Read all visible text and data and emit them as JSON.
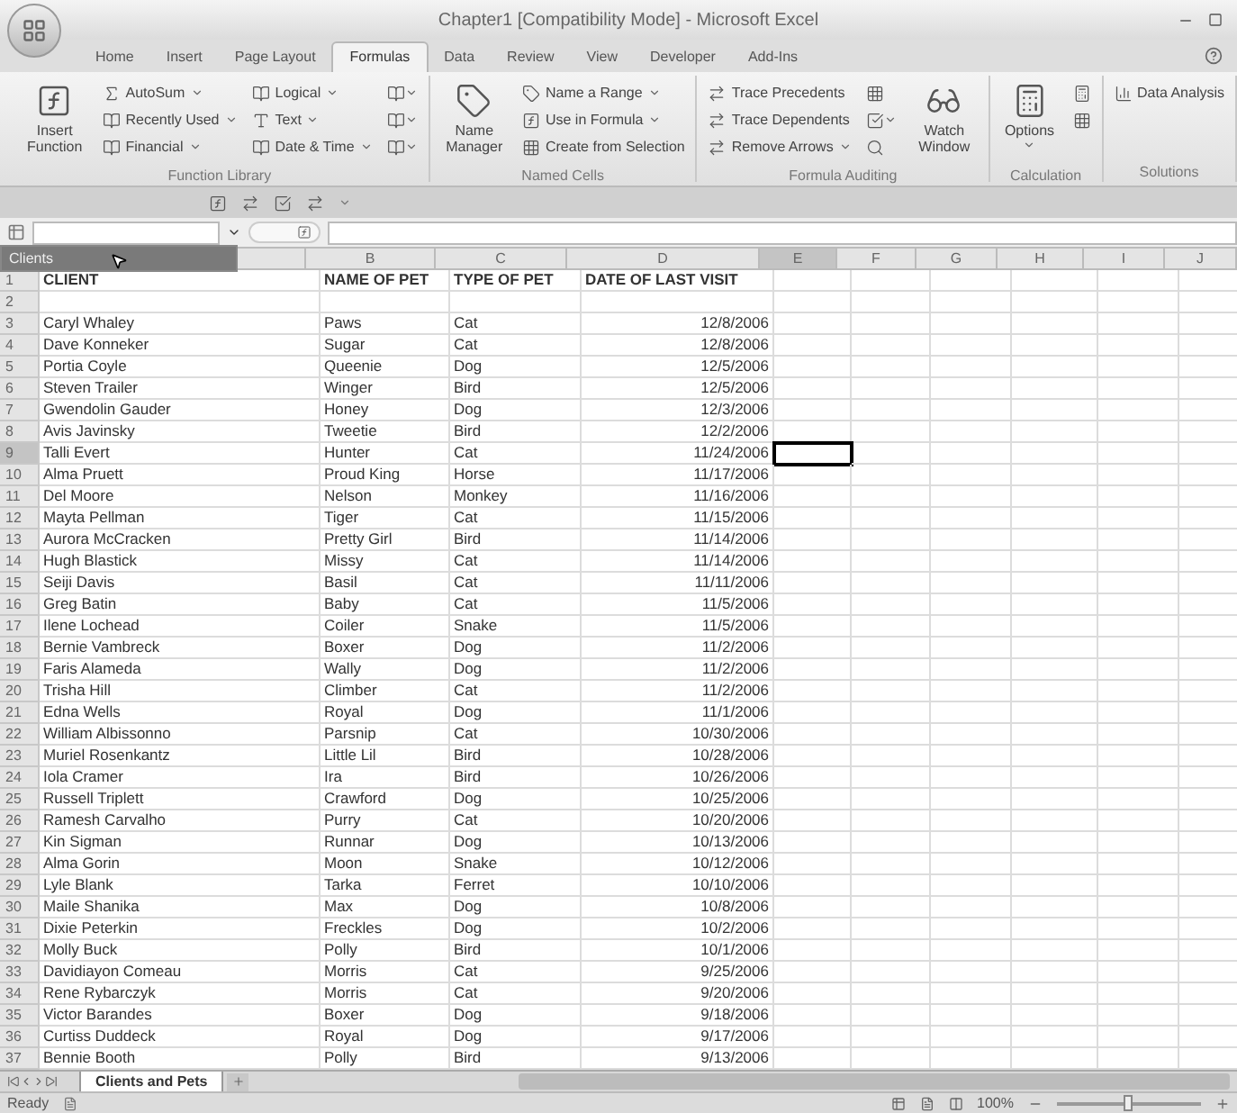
{
  "window": {
    "title": "Chapter1  [Compatibility Mode] - Microsoft Excel"
  },
  "tabs": [
    {
      "label": "Home",
      "selected": false
    },
    {
      "label": "Insert",
      "selected": false
    },
    {
      "label": "Page Layout",
      "selected": false
    },
    {
      "label": "Formulas",
      "selected": true
    },
    {
      "label": "Data",
      "selected": false
    },
    {
      "label": "Review",
      "selected": false
    },
    {
      "label": "View",
      "selected": false
    },
    {
      "label": "Developer",
      "selected": false
    },
    {
      "label": "Add-Ins",
      "selected": false
    }
  ],
  "ribbon_groups": [
    {
      "label": "Function Library",
      "items": [
        {
          "kind": "large",
          "label": "Insert Function",
          "menu": false
        },
        {
          "kind": "small",
          "label": "AutoSum",
          "menu": true
        },
        {
          "kind": "small",
          "label": "Recently Used",
          "menu": true
        },
        {
          "kind": "small",
          "label": "Financial",
          "menu": true
        },
        {
          "kind": "small",
          "label": "Logical",
          "menu": true
        },
        {
          "kind": "small",
          "label": "Text",
          "menu": true
        },
        {
          "kind": "small",
          "label": "Date & Time",
          "menu": true
        },
        {
          "kind": "icon",
          "menu": true
        },
        {
          "kind": "icon",
          "menu": true
        },
        {
          "kind": "icon",
          "menu": true
        }
      ]
    },
    {
      "label": "Named Cells",
      "items": [
        {
          "kind": "large",
          "label": "Name Manager",
          "menu": false
        },
        {
          "kind": "small",
          "label": "Name a Range",
          "menu": true
        },
        {
          "kind": "small",
          "label": "Use in Formula",
          "menu": true
        },
        {
          "kind": "small",
          "label": "Create from Selection",
          "menu": false
        }
      ]
    },
    {
      "label": "Formula Auditing",
      "items": [
        {
          "kind": "small",
          "label": "Trace Precedents",
          "menu": false
        },
        {
          "kind": "small",
          "label": "Trace Dependents",
          "menu": false
        },
        {
          "kind": "small",
          "label": "Remove Arrows",
          "menu": true
        },
        {
          "kind": "icon",
          "menu": false
        },
        {
          "kind": "icon",
          "menu": true
        },
        {
          "kind": "icon",
          "menu": false
        },
        {
          "kind": "large",
          "label": "Watch Window",
          "menu": false
        }
      ]
    },
    {
      "label": "Calculation",
      "items": [
        {
          "kind": "large",
          "label": "Options",
          "menu": true
        },
        {
          "kind": "icon",
          "menu": false
        },
        {
          "kind": "icon",
          "menu": false
        }
      ]
    },
    {
      "label": "Solutions",
      "items": [
        {
          "kind": "small",
          "label": "Data Analysis",
          "menu": false
        }
      ]
    }
  ],
  "name_box_list": {
    "items": [
      {
        "label": "Clients",
        "selected": true
      }
    ]
  },
  "columns": [
    {
      "label": "B",
      "selected": false
    },
    {
      "label": "C",
      "selected": false
    },
    {
      "label": "D",
      "selected": false
    },
    {
      "label": "E",
      "selected": true
    },
    {
      "label": "F",
      "selected": false
    },
    {
      "label": "G",
      "selected": false
    },
    {
      "label": "H",
      "selected": false
    },
    {
      "label": "I",
      "selected": false
    },
    {
      "label": "J",
      "selected": false
    }
  ],
  "rows": [
    {
      "n": "1",
      "kind": "header",
      "selected": false,
      "cells": [
        "CLIENT",
        "NAME OF PET",
        "TYPE OF PET",
        "DATE OF LAST VISIT"
      ]
    },
    {
      "n": "2",
      "kind": "data",
      "selected": false,
      "cells": []
    },
    {
      "n": "3",
      "kind": "data",
      "selected": false,
      "cells": [
        "Caryl Whaley",
        "Paws",
        "Cat",
        "12/8/2006"
      ]
    },
    {
      "n": "4",
      "kind": "data",
      "selected": false,
      "cells": [
        "Dave Konneker",
        "Sugar",
        "Cat",
        "12/8/2006"
      ]
    },
    {
      "n": "5",
      "kind": "data",
      "selected": false,
      "cells": [
        "Portia Coyle",
        "Queenie",
        "Dog",
        "12/5/2006"
      ]
    },
    {
      "n": "6",
      "kind": "data",
      "selected": false,
      "cells": [
        "Steven Trailer",
        "Winger",
        "Bird",
        "12/5/2006"
      ]
    },
    {
      "n": "7",
      "kind": "data",
      "selected": false,
      "cells": [
        "Gwendolin Gauder",
        "Honey",
        "Dog",
        "12/3/2006"
      ]
    },
    {
      "n": "8",
      "kind": "data",
      "selected": false,
      "cells": [
        "Avis Javinsky",
        "Tweetie",
        "Bird",
        "12/2/2006"
      ]
    },
    {
      "n": "9",
      "kind": "data",
      "selected": true,
      "cells": [
        "Talli Evert",
        "Hunter",
        "Cat",
        "11/24/2006"
      ]
    },
    {
      "n": "10",
      "kind": "data",
      "selected": false,
      "cells": [
        "Alma Pruett",
        "Proud King",
        "Horse",
        "11/17/2006"
      ]
    },
    {
      "n": "11",
      "kind": "data",
      "selected": false,
      "cells": [
        "Del Moore",
        "Nelson",
        "Monkey",
        "11/16/2006"
      ]
    },
    {
      "n": "12",
      "kind": "data",
      "selected": false,
      "cells": [
        "Mayta Pellman",
        "Tiger",
        "Cat",
        "11/15/2006"
      ]
    },
    {
      "n": "13",
      "kind": "data",
      "selected": false,
      "cells": [
        "Aurora McCracken",
        "Pretty Girl",
        "Bird",
        "11/14/2006"
      ]
    },
    {
      "n": "14",
      "kind": "data",
      "selected": false,
      "cells": [
        "Hugh Blastick",
        "Missy",
        "Cat",
        "11/14/2006"
      ]
    },
    {
      "n": "15",
      "kind": "data",
      "selected": false,
      "cells": [
        "Seiji Davis",
        "Basil",
        "Cat",
        "11/11/2006"
      ]
    },
    {
      "n": "16",
      "kind": "data",
      "selected": false,
      "cells": [
        "Greg Batin",
        "Baby",
        "Cat",
        "11/5/2006"
      ]
    },
    {
      "n": "17",
      "kind": "data",
      "selected": false,
      "cells": [
        "Ilene Lochead",
        "Coiler",
        "Snake",
        "11/5/2006"
      ]
    },
    {
      "n": "18",
      "kind": "data",
      "selected": false,
      "cells": [
        "Bernie Vambreck",
        "Boxer",
        "Dog",
        "11/2/2006"
      ]
    },
    {
      "n": "19",
      "kind": "data",
      "selected": false,
      "cells": [
        "Faris Alameda",
        "Wally",
        "Dog",
        "11/2/2006"
      ]
    },
    {
      "n": "20",
      "kind": "data",
      "selected": false,
      "cells": [
        "Trisha Hill",
        "Climber",
        "Cat",
        "11/2/2006"
      ]
    },
    {
      "n": "21",
      "kind": "data",
      "selected": false,
      "cells": [
        "Edna Wells",
        "Royal",
        "Dog",
        "11/1/2006"
      ]
    },
    {
      "n": "22",
      "kind": "data",
      "selected": false,
      "cells": [
        "William Albissonno",
        "Parsnip",
        "Cat",
        "10/30/2006"
      ]
    },
    {
      "n": "23",
      "kind": "data",
      "selected": false,
      "cells": [
        "Muriel Rosenkantz",
        "Little Lil",
        "Bird",
        "10/28/2006"
      ]
    },
    {
      "n": "24",
      "kind": "data",
      "selected": false,
      "cells": [
        "Iola Cramer",
        "Ira",
        "Bird",
        "10/26/2006"
      ]
    },
    {
      "n": "25",
      "kind": "data",
      "selected": false,
      "cells": [
        "Russell Triplett",
        "Crawford",
        "Dog",
        "10/25/2006"
      ]
    },
    {
      "n": "26",
      "kind": "data",
      "selected": false,
      "cells": [
        "Ramesh Carvalho",
        "Purry",
        "Cat",
        "10/20/2006"
      ]
    },
    {
      "n": "27",
      "kind": "data",
      "selected": false,
      "cells": [
        "Kin Sigman",
        "Runnar",
        "Dog",
        "10/13/2006"
      ]
    },
    {
      "n": "28",
      "kind": "data",
      "selected": false,
      "cells": [
        "Alma Gorin",
        "Moon",
        "Snake",
        "10/12/2006"
      ]
    },
    {
      "n": "29",
      "kind": "data",
      "selected": false,
      "cells": [
        "Lyle Blank",
        "Tarka",
        "Ferret",
        "10/10/2006"
      ]
    },
    {
      "n": "30",
      "kind": "data",
      "selected": false,
      "cells": [
        "Maile Shanika",
        "Max",
        "Dog",
        "10/8/2006"
      ]
    },
    {
      "n": "31",
      "kind": "data",
      "selected": false,
      "cells": [
        "Dixie Peterkin",
        "Freckles",
        "Dog",
        "10/2/2006"
      ]
    },
    {
      "n": "32",
      "kind": "data",
      "selected": false,
      "cells": [
        "Molly Buck",
        "Polly",
        "Bird",
        "10/1/2006"
      ]
    },
    {
      "n": "33",
      "kind": "data",
      "selected": false,
      "cells": [
        "Davidiayon Comeau",
        "Morris",
        "Cat",
        "9/25/2006"
      ]
    },
    {
      "n": "34",
      "kind": "data",
      "selected": false,
      "cells": [
        "Rene Rybarczyk",
        "Morris",
        "Cat",
        "9/20/2006"
      ]
    },
    {
      "n": "35",
      "kind": "data",
      "selected": false,
      "cells": [
        "Victor Barandes",
        "Boxer",
        "Dog",
        "9/18/2006"
      ]
    },
    {
      "n": "36",
      "kind": "data",
      "selected": false,
      "cells": [
        "Curtiss Duddeck",
        "Royal",
        "Dog",
        "9/17/2006"
      ]
    },
    {
      "n": "37",
      "kind": "data",
      "selected": false,
      "cells": [
        "Bennie Booth",
        "Polly",
        "Bird",
        "9/13/2006"
      ]
    }
  ],
  "sheet_tabs": [
    {
      "label": "Clients and Pets",
      "selected": true
    }
  ],
  "status_bar": {
    "status": "Ready",
    "zoom": "100%",
    "zoom_slider": {
      "level": 0.5
    }
  }
}
